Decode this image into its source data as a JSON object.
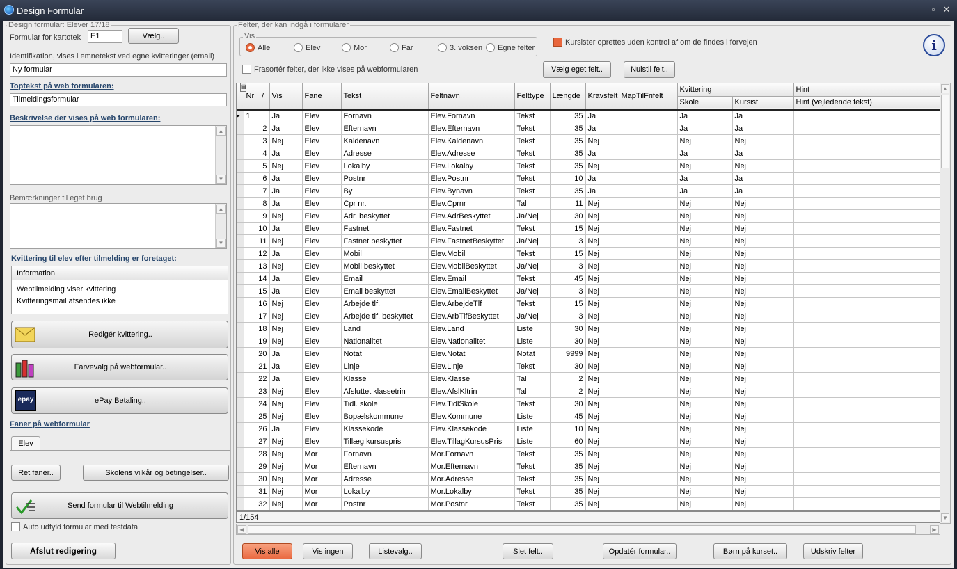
{
  "window": {
    "title": "Design Formular"
  },
  "left": {
    "design_legend": "Design formular: Elever 17/18",
    "kartotek_label": "Formular for kartotek",
    "kartotek_value": "E1",
    "vaelg_button": "Vælg..",
    "ident_label": "Identifikation, vises i emnetekst ved egne kvitteringer (email)",
    "ident_value": "Ny formular",
    "toptekst_label": "Toptekst på web formularen:",
    "toptekst_value": "Tilmeldingsformular",
    "beskrivelse_label": "Beskrivelse der vises på web formularen:",
    "bemaerkninger_label": "Bemærkninger til eget brug",
    "kvittering_label": "Kvittering til elev efter tilmelding er foretaget:",
    "info_header": "Information",
    "info_lines": [
      "Webtilmelding viser kvittering",
      "Kvitteringsmail afsendes ikke"
    ],
    "rediger_button": "Redigér kvittering..",
    "farvevalg_button": "Farvevalg på webformular..",
    "epay_button": "ePay Betaling..",
    "epay_icon_text": "epay",
    "faner_label": "Faner på webformular",
    "tab_elev": "Elev",
    "ret_faner_button": "Ret faner..",
    "vilkaar_button": "Skolens vilkår og betingelser..",
    "send_button": "Send formular til Webtilmelding",
    "auto_label": "Auto udfyld formular med testdata",
    "afslut_button": "Afslut redigering"
  },
  "right": {
    "felter_legend": "Felter, der kan indgå i formularer",
    "vis_legend": "Vis",
    "radios": [
      "Alle",
      "Elev",
      "Mor",
      "Far",
      "3. voksen",
      "Egne felter"
    ],
    "kursister_label": "Kursister oprettes uden kontrol af om de findes i forvejen",
    "frasorter_label": "Frasortér felter, der ikke vises på webformularen",
    "vaelg_eget_button": "Vælg eget felt..",
    "nulstil_button": "Nulstil felt..",
    "info_icon": "i"
  },
  "grid": {
    "headers": [
      "Nr",
      "Vis",
      "Fane",
      "Tekst",
      "Feltnavn",
      "Felttype",
      "Længde",
      "Kravsfelt",
      "MapTilFrifelt",
      "Kvittering",
      "Hint"
    ],
    "sort_mark": "/",
    "sub_headers": [
      "Skole",
      "Kursist",
      "Hint (vejledende tekst)"
    ],
    "rows": [
      [
        "1",
        "Ja",
        "Elev",
        "Fornavn",
        "Elev.Fornavn",
        "Tekst",
        "35",
        "Ja",
        "",
        "Ja",
        "Ja",
        ""
      ],
      [
        "2",
        "Ja",
        "Elev",
        "Efternavn",
        "Elev.Efternavn",
        "Tekst",
        "35",
        "Ja",
        "",
        "Ja",
        "Ja",
        ""
      ],
      [
        "3",
        "Nej",
        "Elev",
        "Kaldenavn",
        "Elev.Kaldenavn",
        "Tekst",
        "35",
        "Nej",
        "",
        "Nej",
        "Nej",
        ""
      ],
      [
        "4",
        "Ja",
        "Elev",
        "Adresse",
        "Elev.Adresse",
        "Tekst",
        "35",
        "Ja",
        "",
        "Ja",
        "Ja",
        ""
      ],
      [
        "5",
        "Nej",
        "Elev",
        "Lokalby",
        "Elev.Lokalby",
        "Tekst",
        "35",
        "Nej",
        "",
        "Nej",
        "Nej",
        ""
      ],
      [
        "6",
        "Ja",
        "Elev",
        "Postnr",
        "Elev.Postnr",
        "Tekst",
        "10",
        "Ja",
        "",
        "Ja",
        "Ja",
        ""
      ],
      [
        "7",
        "Ja",
        "Elev",
        "By",
        "Elev.Bynavn",
        "Tekst",
        "35",
        "Ja",
        "",
        "Ja",
        "Ja",
        ""
      ],
      [
        "8",
        "Ja",
        "Elev",
        "Cpr nr.",
        "Elev.Cprnr",
        "Tal",
        "11",
        "Nej",
        "",
        "Nej",
        "Nej",
        ""
      ],
      [
        "9",
        "Nej",
        "Elev",
        "Adr. beskyttet",
        "Elev.AdrBeskyttet",
        "Ja/Nej",
        "30",
        "Nej",
        "",
        "Nej",
        "Nej",
        ""
      ],
      [
        "10",
        "Ja",
        "Elev",
        "Fastnet",
        "Elev.Fastnet",
        "Tekst",
        "15",
        "Nej",
        "",
        "Nej",
        "Nej",
        ""
      ],
      [
        "11",
        "Nej",
        "Elev",
        "Fastnet beskyttet",
        "Elev.FastnetBeskyttet",
        "Ja/Nej",
        "3",
        "Nej",
        "",
        "Nej",
        "Nej",
        ""
      ],
      [
        "12",
        "Ja",
        "Elev",
        "Mobil",
        "Elev.Mobil",
        "Tekst",
        "15",
        "Nej",
        "",
        "Nej",
        "Nej",
        ""
      ],
      [
        "13",
        "Nej",
        "Elev",
        "Mobil beskyttet",
        "Elev.MobilBeskyttet",
        "Ja/Nej",
        "3",
        "Nej",
        "",
        "Nej",
        "Nej",
        ""
      ],
      [
        "14",
        "Ja",
        "Elev",
        "Email",
        "Elev.Email",
        "Tekst",
        "45",
        "Nej",
        "",
        "Nej",
        "Nej",
        ""
      ],
      [
        "15",
        "Ja",
        "Elev",
        "Email beskyttet",
        "Elev.EmailBeskyttet",
        "Ja/Nej",
        "3",
        "Nej",
        "",
        "Nej",
        "Nej",
        ""
      ],
      [
        "16",
        "Nej",
        "Elev",
        "Arbejde tlf.",
        "Elev.ArbejdeTlf",
        "Tekst",
        "15",
        "Nej",
        "",
        "Nej",
        "Nej",
        ""
      ],
      [
        "17",
        "Nej",
        "Elev",
        "Arbejde tlf. beskyttet",
        "Elev.ArbTlfBeskyttet",
        "Ja/Nej",
        "3",
        "Nej",
        "",
        "Nej",
        "Nej",
        ""
      ],
      [
        "18",
        "Nej",
        "Elev",
        "Land",
        "Elev.Land",
        "Liste",
        "30",
        "Nej",
        "",
        "Nej",
        "Nej",
        ""
      ],
      [
        "19",
        "Nej",
        "Elev",
        "Nationalitet",
        "Elev.Nationalitet",
        "Liste",
        "30",
        "Nej",
        "",
        "Nej",
        "Nej",
        ""
      ],
      [
        "20",
        "Ja",
        "Elev",
        "Notat",
        "Elev.Notat",
        "Notat",
        "9999",
        "Nej",
        "",
        "Nej",
        "Nej",
        ""
      ],
      [
        "21",
        "Ja",
        "Elev",
        "Linje",
        "Elev.Linje",
        "Tekst",
        "30",
        "Nej",
        "",
        "Nej",
        "Nej",
        ""
      ],
      [
        "22",
        "Ja",
        "Elev",
        "Klasse",
        "Elev.Klasse",
        "Tal",
        "2",
        "Nej",
        "",
        "Nej",
        "Nej",
        ""
      ],
      [
        "23",
        "Nej",
        "Elev",
        "Afsluttet klassetrin",
        "Elev.AfslKltrin",
        "Tal",
        "2",
        "Nej",
        "",
        "Nej",
        "Nej",
        ""
      ],
      [
        "24",
        "Nej",
        "Elev",
        "Tidl. skole",
        "Elev.TidlSkole",
        "Tekst",
        "30",
        "Nej",
        "",
        "Nej",
        "Nej",
        ""
      ],
      [
        "25",
        "Nej",
        "Elev",
        "Bopælskommune",
        "Elev.Kommune",
        "Liste",
        "45",
        "Nej",
        "",
        "Nej",
        "Nej",
        ""
      ],
      [
        "26",
        "Ja",
        "Elev",
        "Klassekode",
        "Elev.Klassekode",
        "Liste",
        "10",
        "Nej",
        "",
        "Nej",
        "Nej",
        ""
      ],
      [
        "27",
        "Nej",
        "Elev",
        "Tillæg kursuspris",
        "Elev.TillagKursusPris",
        "Liste",
        "60",
        "Nej",
        "",
        "Nej",
        "Nej",
        ""
      ],
      [
        "28",
        "Nej",
        "Mor",
        "Fornavn",
        "Mor.Fornavn",
        "Tekst",
        "35",
        "Nej",
        "",
        "Nej",
        "Nej",
        ""
      ],
      [
        "29",
        "Nej",
        "Mor",
        "Efternavn",
        "Mor.Efternavn",
        "Tekst",
        "35",
        "Nej",
        "",
        "Nej",
        "Nej",
        ""
      ],
      [
        "30",
        "Nej",
        "Mor",
        "Adresse",
        "Mor.Adresse",
        "Tekst",
        "35",
        "Nej",
        "",
        "Nej",
        "Nej",
        ""
      ],
      [
        "31",
        "Nej",
        "Mor",
        "Lokalby",
        "Mor.Lokalby",
        "Tekst",
        "35",
        "Nej",
        "",
        "Nej",
        "Nej",
        ""
      ],
      [
        "32",
        "Nej",
        "Mor",
        "Postnr",
        "Mor.Postnr",
        "Tekst",
        "35",
        "Nej",
        "",
        "Nej",
        "Nej",
        ""
      ]
    ],
    "record_count": "1/154"
  },
  "bottom_buttons": [
    "Vis alle",
    "Vis ingen",
    "Listevalg..",
    "Slet felt..",
    "Opdatér formular..",
    "Børn på kurset..",
    "Udskriv felter"
  ],
  "colors": {
    "accent": "#e8663c",
    "title_bar": "#2b3344"
  }
}
